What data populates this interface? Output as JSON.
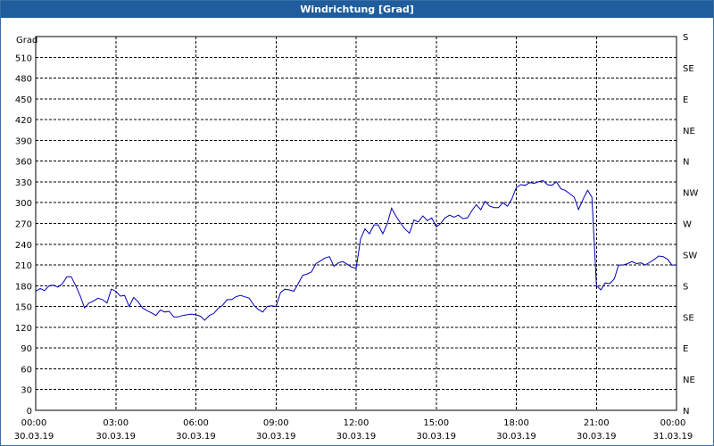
{
  "window": {
    "title": "Windrichtung [Grad]"
  },
  "chart_data": {
    "type": "line",
    "title": "Windrichtung [Grad]",
    "ylabel": "Grad",
    "ylim": [
      0,
      540
    ],
    "yticks": [
      0,
      30,
      60,
      90,
      120,
      150,
      180,
      210,
      240,
      270,
      300,
      330,
      360,
      390,
      420,
      450,
      480,
      510
    ],
    "right_axis_labels": [
      {
        "value": 0,
        "label": "N"
      },
      {
        "value": 45,
        "label": "NE"
      },
      {
        "value": 90,
        "label": "E"
      },
      {
        "value": 135,
        "label": "SE"
      },
      {
        "value": 180,
        "label": "S"
      },
      {
        "value": 225,
        "label": "SW"
      },
      {
        "value": 270,
        "label": "W"
      },
      {
        "value": 315,
        "label": "NW"
      },
      {
        "value": 360,
        "label": "N"
      },
      {
        "value": 405,
        "label": "NE"
      },
      {
        "value": 450,
        "label": "E"
      },
      {
        "value": 495,
        "label": "SE"
      },
      {
        "value": 540,
        "label": "S"
      }
    ],
    "xlim": [
      0,
      24
    ],
    "xticks": [
      {
        "hour": 0,
        "time": "00:00",
        "date": "30.03.19"
      },
      {
        "hour": 3,
        "time": "03:00",
        "date": "30.03.19"
      },
      {
        "hour": 6,
        "time": "06:00",
        "date": "30.03.19"
      },
      {
        "hour": 9,
        "time": "09:00",
        "date": "30.03.19"
      },
      {
        "hour": 12,
        "time": "12:00",
        "date": "30.03.19"
      },
      {
        "hour": 15,
        "time": "15:00",
        "date": "30.03.19"
      },
      {
        "hour": 18,
        "time": "18:00",
        "date": "30.03.19"
      },
      {
        "hour": 21,
        "time": "21:00",
        "date": "30.03.19"
      },
      {
        "hour": 24,
        "time": "00:00",
        "date": "31.03.19"
      }
    ],
    "grid": true,
    "line_color": "#0000b4",
    "series": [
      {
        "x": [
          0,
          0.17,
          0.33,
          0.5,
          0.67,
          0.83,
          1.0,
          1.17,
          1.33,
          1.5,
          1.67,
          1.83,
          2.0,
          2.17,
          2.33,
          2.5,
          2.67,
          2.83,
          3.0,
          3.17,
          3.33,
          3.5,
          3.67,
          3.83,
          4.0,
          4.17,
          4.33,
          4.5,
          4.67,
          4.83,
          5.0,
          5.17,
          5.33,
          5.5,
          5.67,
          5.83,
          6.0,
          6.17,
          6.33,
          6.5,
          6.67,
          6.83,
          7.0,
          7.17,
          7.33,
          7.5,
          7.67,
          7.83,
          8.0,
          8.17,
          8.33,
          8.5,
          8.67,
          8.83,
          9.0,
          9.17,
          9.33,
          9.5,
          9.67,
          9.83,
          10.0,
          10.17,
          10.33,
          10.5,
          10.67,
          10.83,
          11.0,
          11.17,
          11.33,
          11.5,
          11.67,
          11.83,
          12.0,
          12.17,
          12.33,
          12.5,
          12.67,
          12.83,
          13.0,
          13.17,
          13.33,
          13.5,
          13.67,
          13.83,
          14.0,
          14.17,
          14.33,
          14.5,
          14.67,
          14.83,
          15.0,
          15.17,
          15.33,
          15.5,
          15.67,
          15.83,
          16.0,
          16.17,
          16.33,
          16.5,
          16.67,
          16.83,
          17.0,
          17.17,
          17.33,
          17.5,
          17.67,
          17.83,
          18.0,
          18.17,
          18.33,
          18.5,
          18.67,
          18.83,
          19.0,
          19.17,
          19.33,
          19.5,
          19.67,
          19.83,
          20.0,
          20.17,
          20.33,
          20.5,
          20.67,
          20.83,
          21.0,
          21.17,
          21.33,
          21.5,
          21.67,
          21.83,
          22.0,
          22.17,
          22.33,
          22.5,
          22.67,
          22.83,
          23.0,
          23.17,
          23.33,
          23.5,
          23.67,
          23.83,
          24.0
        ],
        "y": [
          172,
          176,
          173,
          180,
          181,
          178,
          183,
          193,
          193,
          180,
          165,
          148,
          155,
          158,
          162,
          160,
          155,
          175,
          172,
          165,
          166,
          150,
          163,
          157,
          148,
          144,
          141,
          137,
          145,
          142,
          143,
          135,
          135,
          137,
          138,
          139,
          138,
          136,
          130,
          137,
          140,
          147,
          152,
          160,
          160,
          164,
          166,
          164,
          162,
          152,
          146,
          142,
          150,
          151,
          150,
          170,
          175,
          174,
          172,
          183,
          195,
          197,
          200,
          212,
          216,
          220,
          222,
          208,
          213,
          215,
          211,
          207,
          205,
          248,
          262,
          255,
          268,
          268,
          255,
          270,
          292,
          280,
          270,
          262,
          256,
          275,
          272,
          281,
          274,
          278,
          265,
          270,
          278,
          282,
          279,
          282,
          277,
          278,
          288,
          297,
          290,
          302,
          295,
          293,
          293,
          300,
          295,
          305,
          322,
          326,
          325,
          329,
          328,
          330,
          332,
          326,
          325,
          330,
          320,
          318,
          313,
          308,
          290,
          305,
          318,
          308,
          180,
          174,
          184,
          183,
          190,
          210,
          210,
          212,
          215,
          212,
          213,
          210,
          214,
          218,
          223,
          222,
          218,
          210,
          210
        ]
      }
    ]
  }
}
